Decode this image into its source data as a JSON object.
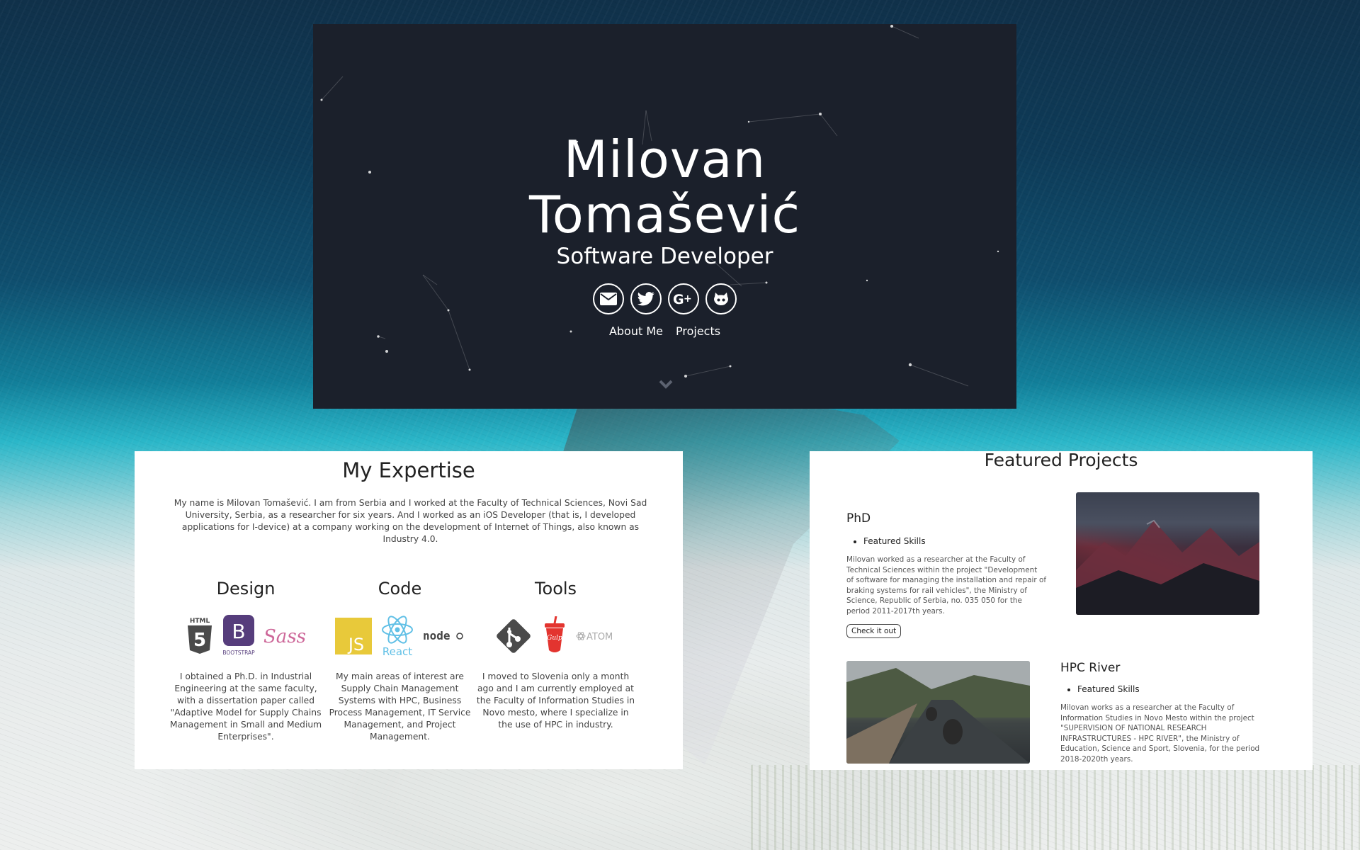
{
  "hero": {
    "name_line1": "Milovan",
    "name_line2": "Tomašević",
    "subtitle": "Software Developer",
    "social": [
      {
        "icon": "envelope-icon"
      },
      {
        "icon": "twitter-icon"
      },
      {
        "icon": "google-plus-icon"
      },
      {
        "icon": "github-icon"
      }
    ],
    "nav": [
      {
        "label": "About Me"
      },
      {
        "label": "Projects"
      }
    ],
    "scroll_icon": "chevron-down-icon"
  },
  "expertise": {
    "title": "My Expertise",
    "intro": "My name is Milovan Tomašević. I am from Serbia and I worked at the Faculty of Technical Sciences, Novi Sad University, Serbia, as a researcher for six years. And I worked as an iOS Developer (that is, I developed applications for I-device) at a company working on the development of Internet of Things, also known as Industry 4.0.",
    "columns": [
      {
        "title": "Design",
        "logos": [
          "html5-logo",
          "bootstrap-logo",
          "sass-logo"
        ],
        "logo_text": [
          "HTML",
          "B",
          "BOOTSTRAP",
          "Sass"
        ],
        "text": "I obtained a Ph.D. in Industrial Engineering at the same faculty, with a dissertation paper called \"Adaptive Model for Supply Chains Management in Small and Medium Enterprises\"."
      },
      {
        "title": "Code",
        "logos": [
          "javascript-logo",
          "react-logo",
          "nodejs-logo"
        ],
        "logo_text": [
          "JS",
          "React",
          "node"
        ],
        "text": "My main areas of interest are Supply Chain Management Systems with HPC, Business Process Management, IT Service Management, and Project Management."
      },
      {
        "title": "Tools",
        "logos": [
          "git-logo",
          "gulp-logo",
          "atom-logo"
        ],
        "logo_text": [
          "Gulp",
          "ATOM"
        ],
        "text": "I moved to Slovenia only a month ago and I am currently employed at the Faculty of Information Studies in Novo mesto, where I specialize in the use of HPC in industry."
      }
    ]
  },
  "projects": {
    "title": "Featured Projects",
    "items": [
      {
        "title": "PhD",
        "skills_label": "Featured Skills",
        "description": "Milovan worked as a researcher at the Faculty of Technical Sciences within the project \"Development of software for managing the installation and repair of braking systems for rail vehicles\", the Ministry of Science, Republic of Serbia, no. 035 050 for the period 2011-2017th years.",
        "button": "Check it out",
        "image": "mountain-photo"
      },
      {
        "title": "HPC River",
        "skills_label": "Featured Skills",
        "description": "Milovan works as a researcher at the Faculty of Information Studies in Novo Mesto within the project \"SUPERVISION OF NATIONAL RESEARCH INFRASTRUCTURES - HPC RIVER\", the Ministry of Education, Science and Sport, Slovenia, for the period 2018-2020th years.",
        "image": "longboard-road-photo"
      }
    ]
  },
  "colors": {
    "hero_bg": "#1b202b",
    "card_bg": "#ffffff",
    "text_dark": "#222222"
  }
}
